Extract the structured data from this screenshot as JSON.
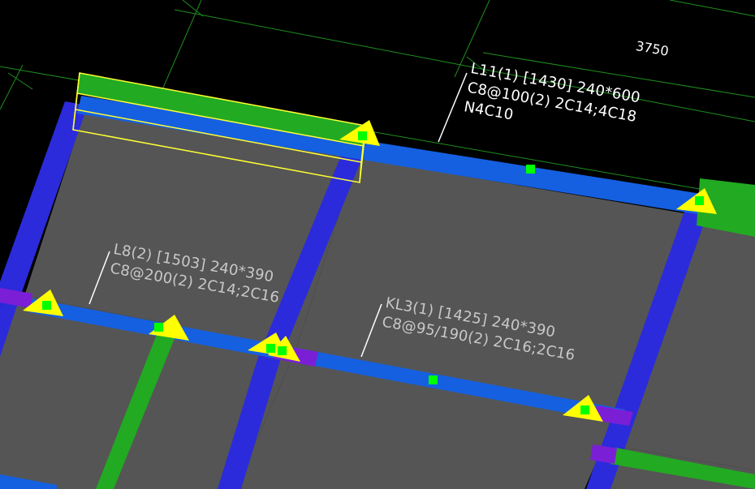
{
  "view": {
    "background_color": "#000000",
    "grid_color": "#1f8f1f",
    "slab_color": "#555555",
    "beam_colors": {
      "frame_beam": "#1560e0",
      "column_band": "#2b2bdb",
      "secondary_beam": "#22aa22",
      "support_zone": "#7a1fd6",
      "selection_outline": "#ffff33"
    },
    "marker_colors": {
      "support_triangle": "#ffff00",
      "grip_point": "#00ff00"
    },
    "label_colors": {
      "selected_label": "#ffffff",
      "normal_label": "#c8c8c8"
    }
  },
  "dimension": {
    "text": "3750"
  },
  "annotations": [
    {
      "beam_id": "L11",
      "selected": true,
      "line1": "L11(1) [1430] 240*600",
      "line2": "C8@100(2) 2C14;4C18",
      "line3": "N4C10"
    },
    {
      "beam_id": "L8",
      "selected": false,
      "line1": "L8(2) [1503] 240*390",
      "line2": "C8@200(2) 2C14;2C16"
    },
    {
      "beam_id": "KL3",
      "selected": false,
      "line1": "KL3(1) [1425] 240*390",
      "line2": "C8@95/190(2) 2C16;2C16"
    }
  ]
}
